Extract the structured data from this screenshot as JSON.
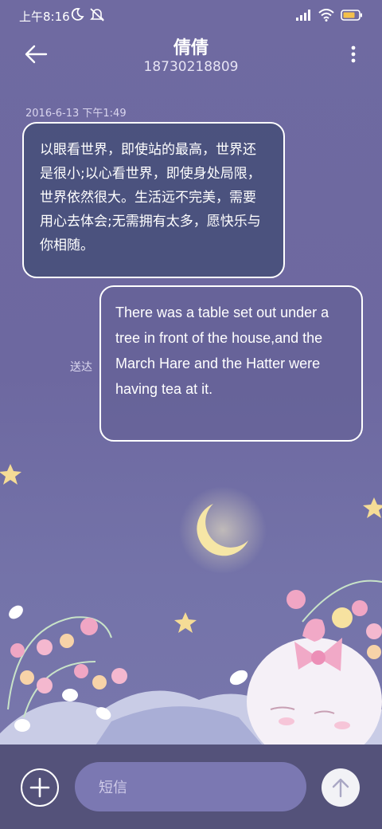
{
  "status": {
    "time": "上午8:16",
    "icons_left": [
      "moon-icon",
      "mute-icon"
    ],
    "icons_right": [
      "signal-icon",
      "wifi-icon",
      "battery-icon"
    ]
  },
  "header": {
    "contact_name": "倩倩",
    "phone_number": "18730218809"
  },
  "conversation": {
    "timestamp": "2016-6-13 下午1:49",
    "incoming_message": "以眼看世界，即使站的最高，世界还是很小;以心看世界，即使身处局限，世界依然很大。生活远不完美，需要用心去体会;无需拥有太多，愿快乐与你相随。",
    "outgoing_message": "There was a table set out under a tree in front of the house,and the March Hare and the Hatter were having tea at it.",
    "delivery_status": "送达"
  },
  "composer": {
    "placeholder": "短信"
  },
  "colors": {
    "background": "#6f6aa1",
    "composer_bar": "#54527a",
    "input_pill": "#7b78b2",
    "incoming_bubble": "#3e4a70"
  }
}
